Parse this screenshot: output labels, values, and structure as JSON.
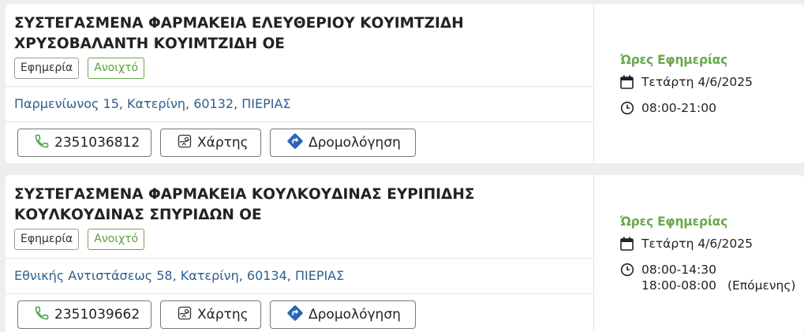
{
  "pharmacies": [
    {
      "name": "ΣΥΣΤΕΓΑΣΜΕΝΑ ΦΑΡΜΑΚΕΙΑ ΕΛΕΥΘΕΡΙΟΥ ΚΟΥΙΜΤΖΙΔΗ ΧΡΥΣΟΒΑΛΑΝΤΗ ΚΟΥΙΜΤΖΙΔΗ ΟΕ",
      "badge_duty": "Εφημερία",
      "badge_open": "Ανοιχτό",
      "address": "Παρμενίωνος 15, Κατερίνη, 60132, ΠΙΕΡΙΑΣ",
      "phone": "2351036812",
      "map_label": "Χάρτης",
      "route_label": "Δρομολόγηση",
      "duty_title": "Ώρες Εφημερίας",
      "date": "Τετάρτη 4/6/2025",
      "hours": [
        "08:00-21:00"
      ],
      "next_label": ""
    },
    {
      "name": "ΣΥΣΤΕΓΑΣΜΕΝΑ ΦΑΡΜΑΚΕΙΑ ΚΟΥΛΚΟΥΔΙΝΑΣ ΕΥΡΙΠΙΔΗΣ ΚΟΥΛΚΟΥΔΙΝΑΣ ΣΠΥΡΙΔΩΝ ΟΕ",
      "badge_duty": "Εφημερία",
      "badge_open": "Ανοιχτό",
      "address": "Εθνικής Αντιστάσεως 58, Κατερίνη, 60134, ΠΙΕΡΙΑΣ",
      "phone": "2351039662",
      "map_label": "Χάρτης",
      "route_label": "Δρομολόγηση",
      "duty_title": "Ώρες Εφημερίας",
      "date": "Τετάρτη 4/6/2025",
      "hours": [
        "08:00-14:30",
        "18:00-08:00"
      ],
      "next_label": "(Επόμενης)"
    }
  ],
  "colors": {
    "green": "#6aa84f",
    "link_blue": "#2d5f8f",
    "route_icon_blue": "#2a66b8",
    "phone_icon_green": "#4aa34a"
  },
  "icons": {
    "phone": "phone-icon",
    "map": "map-icon",
    "route": "route-diamond-icon",
    "calendar": "calendar-icon",
    "clock": "clock-icon"
  }
}
